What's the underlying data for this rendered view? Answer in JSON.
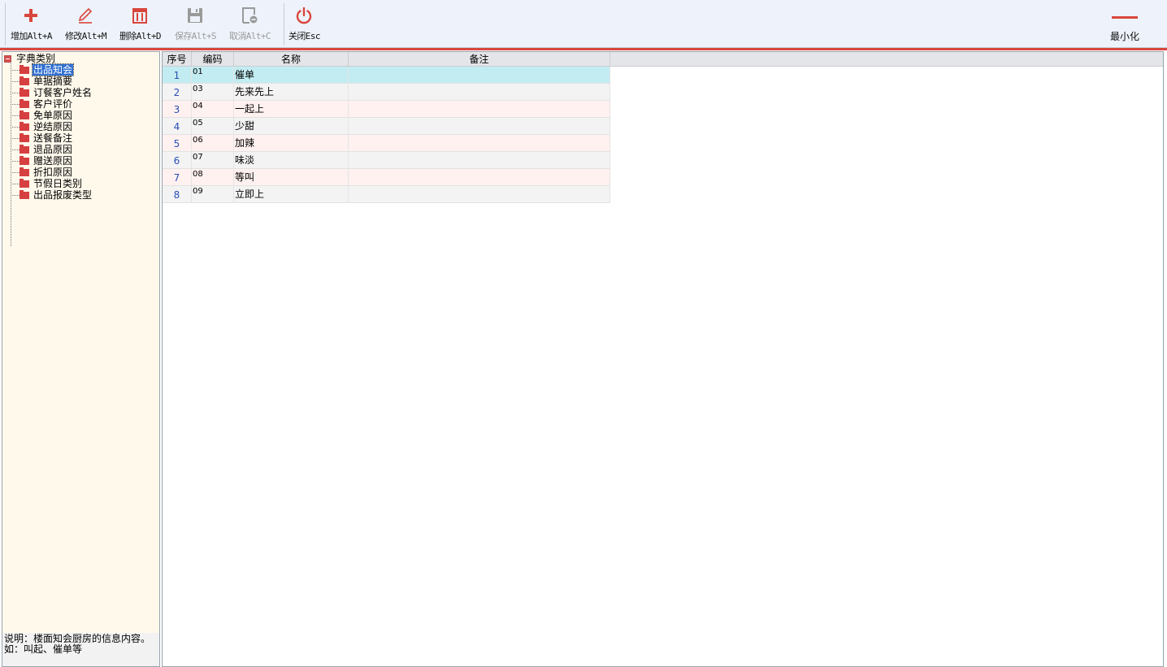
{
  "toolbar": {
    "buttons": [
      {
        "label": "增加Alt+A",
        "icon": "plus-icon",
        "enabled": true
      },
      {
        "label": "修改Alt+M",
        "icon": "pencil-icon",
        "enabled": true
      },
      {
        "label": "删除Alt+D",
        "icon": "trash-icon",
        "enabled": true
      },
      {
        "label": "保存Alt+S",
        "icon": "save-icon",
        "enabled": false
      },
      {
        "label": "取消Alt+C",
        "icon": "cancel-icon",
        "enabled": false
      },
      {
        "label": "关闭Esc",
        "icon": "power-icon",
        "enabled": true
      }
    ],
    "minimize_label": "最小化"
  },
  "tree": {
    "root_label": "字典类别",
    "items": [
      "出品知会",
      "单据摘要",
      "订餐客户姓名",
      "客户评价",
      "免单原因",
      "逆结原因",
      "送餐备注",
      "退品原因",
      "赠送原因",
      "折扣原因",
      "节假日类别",
      "出品报废类型"
    ],
    "selected": "出品知会"
  },
  "description": {
    "line1": "说明：楼面知会厨房的信息内容。",
    "line2": "如：叫起、催单等"
  },
  "grid": {
    "columns": {
      "seq": "序号",
      "code": "编码",
      "name": "名称",
      "note": "备注"
    },
    "rows": [
      {
        "seq": "1",
        "code": "01",
        "name": "催单",
        "note": ""
      },
      {
        "seq": "2",
        "code": "03",
        "name": "先来先上",
        "note": ""
      },
      {
        "seq": "3",
        "code": "04",
        "name": "一起上",
        "note": ""
      },
      {
        "seq": "4",
        "code": "05",
        "name": "少甜",
        "note": ""
      },
      {
        "seq": "5",
        "code": "06",
        "name": "加辣",
        "note": ""
      },
      {
        "seq": "6",
        "code": "07",
        "name": "味淡",
        "note": ""
      },
      {
        "seq": "7",
        "code": "08",
        "name": "等叫",
        "note": ""
      },
      {
        "seq": "8",
        "code": "09",
        "name": "立即上",
        "note": ""
      }
    ]
  },
  "colors": {
    "accent": "#d9463c",
    "selection": "#2f6fd1",
    "selected_row": "#c3ecf2",
    "tree_bg": "#fff9ec"
  }
}
